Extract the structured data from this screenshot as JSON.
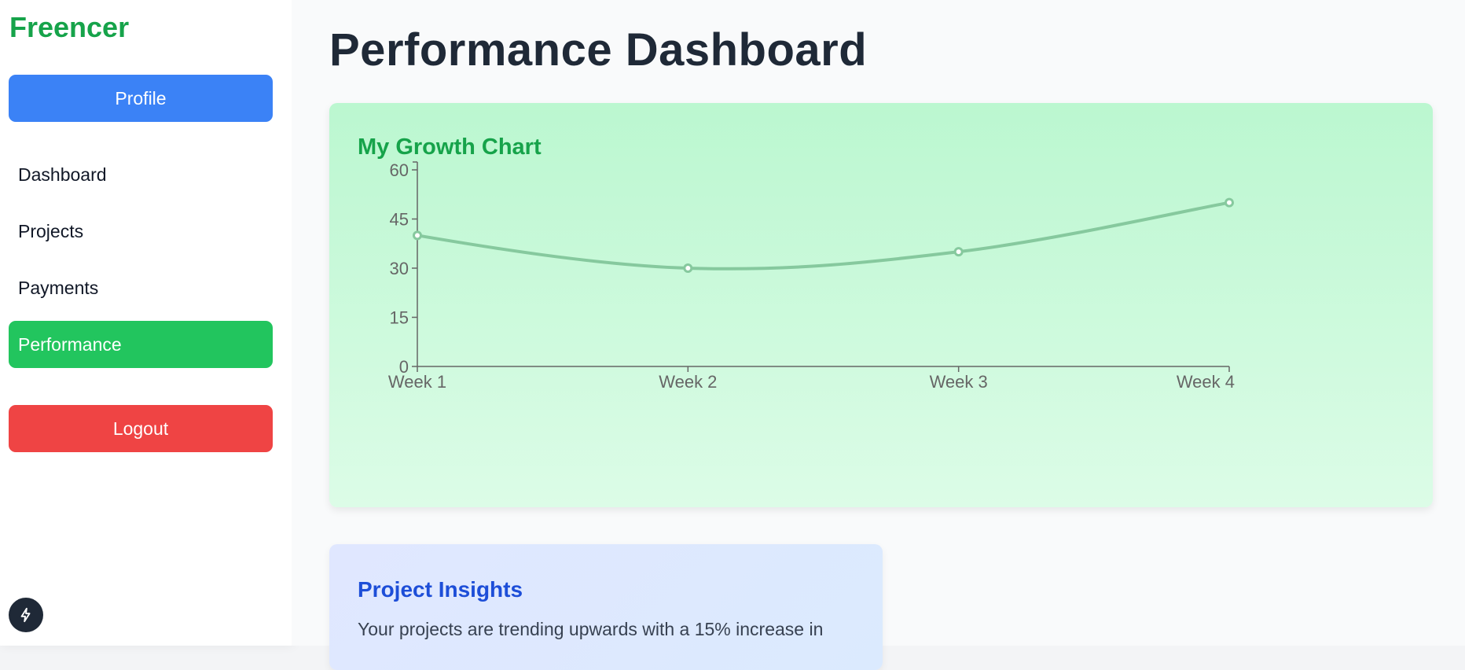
{
  "sidebar": {
    "brand": "Freencer",
    "profile_label": "Profile",
    "items": [
      {
        "label": "Dashboard",
        "active": false
      },
      {
        "label": "Projects",
        "active": false
      },
      {
        "label": "Payments",
        "active": false
      },
      {
        "label": "Performance",
        "active": true
      }
    ],
    "logout_label": "Logout",
    "fab_icon": "lightning-icon"
  },
  "main": {
    "title": "Performance Dashboard",
    "chart_card": {
      "title": "My Growth Chart"
    },
    "insights": {
      "title": "Project Insights",
      "text": "Your projects are trending upwards with a 15% increase in"
    }
  },
  "colors": {
    "brand": "#16a34a",
    "profile": "#3b82f6",
    "active": "#22c55e",
    "logout": "#ef4444",
    "line": "#86c99e",
    "axis": "#666666"
  },
  "chart_data": {
    "type": "line",
    "categories": [
      "Week 1",
      "Week 2",
      "Week 3",
      "Week 4"
    ],
    "series": [
      {
        "values": [
          40,
          30,
          35,
          50
        ]
      }
    ],
    "title": "",
    "xlabel": "",
    "ylabel": "",
    "ylim": [
      0,
      60
    ],
    "yticks": [
      0,
      15,
      30,
      45,
      60
    ],
    "grid": false
  }
}
